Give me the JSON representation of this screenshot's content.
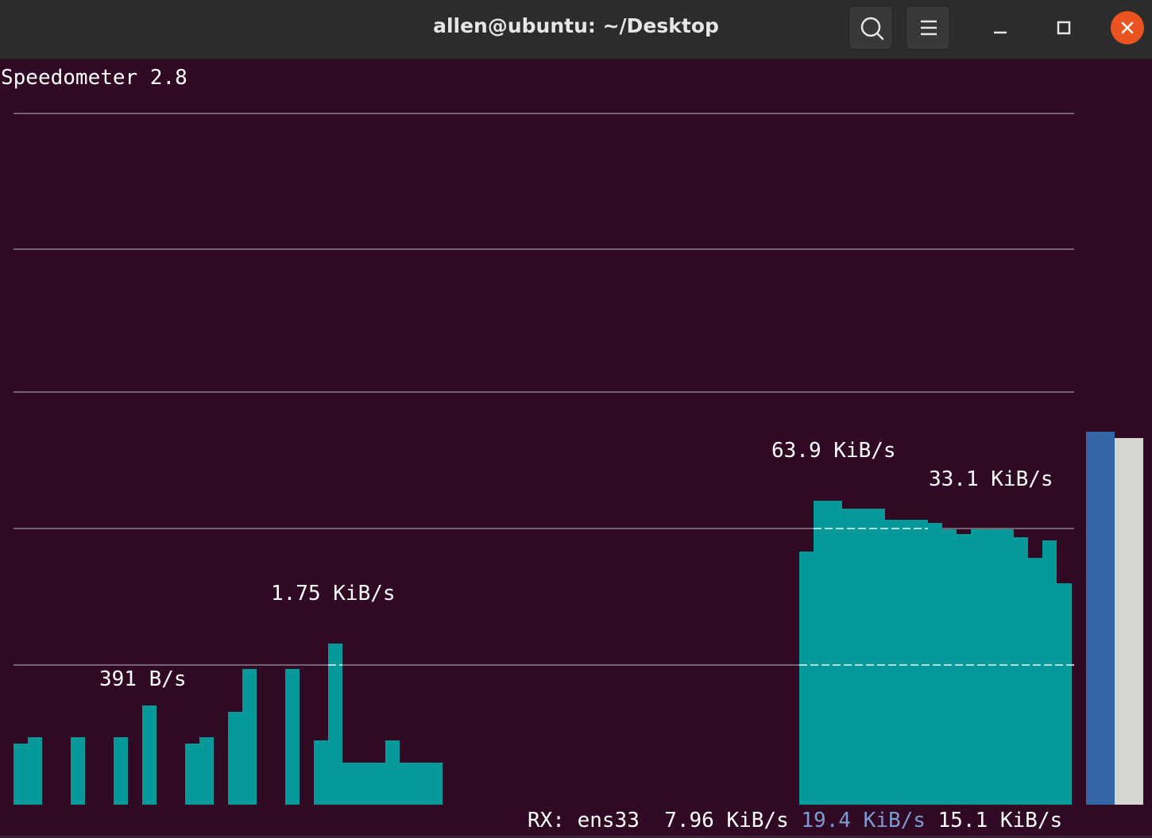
{
  "window": {
    "title": "allen@ubuntu: ~/Desktop",
    "buttons": [
      "search-icon",
      "hamburger-menu-icon",
      "minimize-icon",
      "maximize-icon",
      "close-icon"
    ]
  },
  "terminal": {
    "app_version": "Speedometer 2.8",
    "colors": {
      "background": "#300a24",
      "bar": "#06999a",
      "grid": "#8a7f87",
      "meter_blue": "#3465a4",
      "meter_white": "#d3d7cf",
      "text": "#ffffff",
      "accent_text": "#7c9bd0"
    },
    "graph_labels": {
      "label_391": "391 B/s",
      "label_1_75": "1.75 KiB/s",
      "label_63_9": "63.9 KiB/s",
      "label_33_1": "33.1 KiB/s"
    },
    "status": {
      "interface": "RX: ens33",
      "current_rate": "7.96 KiB/s",
      "average_rate": "19.4 KiB/s",
      "other_rate": "15.1 KiB/s"
    },
    "meters": {
      "blue_level_fraction": 0.54,
      "white_level_fraction": 0.53
    }
  }
}
